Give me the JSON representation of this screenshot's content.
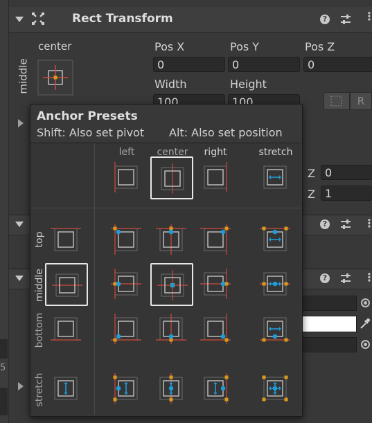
{
  "header": {
    "title": "Rect Transform"
  },
  "anchor_widget": {
    "h_label": "center",
    "v_label": "middle"
  },
  "fields": {
    "pos_x": {
      "label": "Pos X",
      "value": "0"
    },
    "pos_y": {
      "label": "Pos Y",
      "value": "0"
    },
    "pos_z": {
      "label": "Pos Z",
      "value": "0"
    },
    "width": {
      "label": "Width",
      "value": "100"
    },
    "height": {
      "label": "Height",
      "value": "100"
    }
  },
  "side_fields": [
    {
      "label": "Z",
      "value": "0"
    },
    {
      "label": "Z",
      "value": "1"
    }
  ],
  "popup": {
    "title": "Anchor Presets",
    "shift_info": "Shift: Also set pivot",
    "alt_info": "Alt: Also set position",
    "columns": [
      "left",
      "center",
      "right",
      "stretch"
    ],
    "rows": [
      "top",
      "middle",
      "bottom",
      "stretch"
    ],
    "selected_column": "center",
    "selected_row": "middle"
  },
  "colors": {
    "anchor_line": "#d04a3a",
    "handle_orange": "#d89a1c",
    "pivot_blue": "#1f9bd8",
    "selected_border": "#e8e8e8"
  },
  "icons": [
    "collapse-triangle-icon",
    "rect-transform-icon",
    "help-icon",
    "preset-slider-icon",
    "more-menu-icon",
    "blueprint-toggle-icon",
    "raw-edit-icon",
    "object-picker-icon",
    "eyedropper-icon"
  ]
}
